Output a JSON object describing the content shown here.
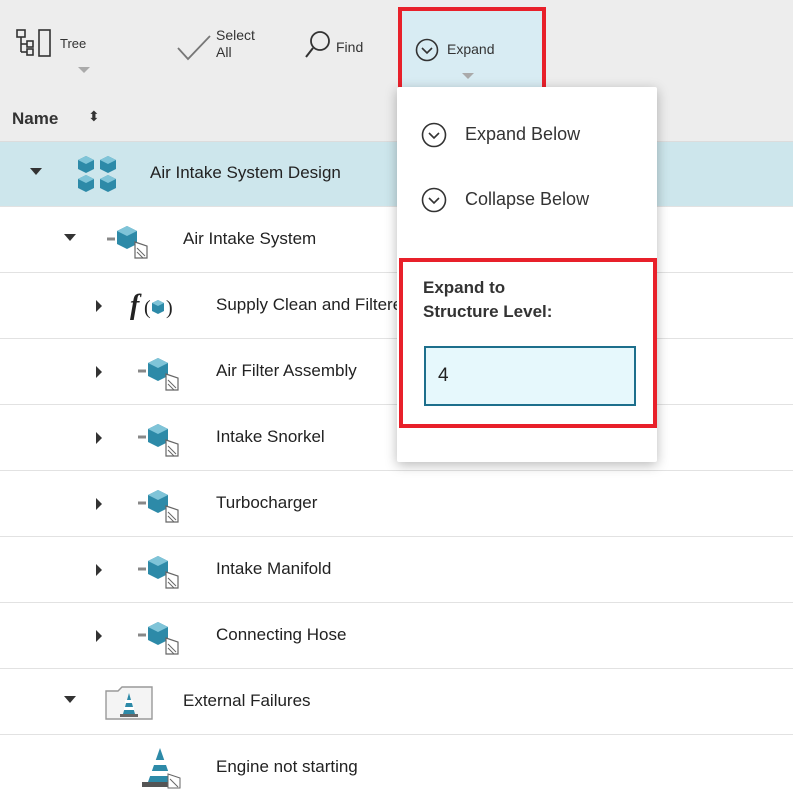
{
  "toolbar": {
    "tree_label": "Tree",
    "select_all_line1": "Select",
    "select_all_line2": "All",
    "find_label": "Find",
    "expand_label": "Expand"
  },
  "table": {
    "name_header": "Name",
    "sort_icon": "⬍"
  },
  "tree": {
    "rows": [
      {
        "label": "Air Intake System Design",
        "icon": "group-icon",
        "expanded": true,
        "selected": true
      },
      {
        "label": "Air Intake System",
        "icon": "system-part-icon",
        "expanded": true
      },
      {
        "label": "Supply Clean and Filtered Air",
        "icon": "function-icon",
        "expanded": false
      },
      {
        "label": "Air Filter Assembly",
        "icon": "system-part-icon",
        "expanded": false
      },
      {
        "label": "Intake Snorkel",
        "icon": "system-part-icon",
        "expanded": false
      },
      {
        "label": "Turbocharger",
        "icon": "system-part-icon",
        "expanded": false
      },
      {
        "label": "Intake Manifold",
        "icon": "system-part-icon",
        "expanded": false
      },
      {
        "label": "Connecting Hose",
        "icon": "system-part-icon",
        "expanded": false
      },
      {
        "label": "External Failures",
        "icon": "failure-folder-icon",
        "expanded": true
      },
      {
        "label": "Engine not starting",
        "icon": "traffic-cone-icon"
      }
    ]
  },
  "expand_menu": {
    "expand_below": "Expand Below",
    "collapse_below": "Collapse Below",
    "level_label_line1": "Expand to",
    "level_label_line2": "Structure Level:",
    "level_value": "4"
  },
  "colors": {
    "highlight": "#e8202a",
    "selected_row": "#cde6ec",
    "toolbar_bg": "#ededed",
    "icon_blue": "#2d8aa8"
  }
}
